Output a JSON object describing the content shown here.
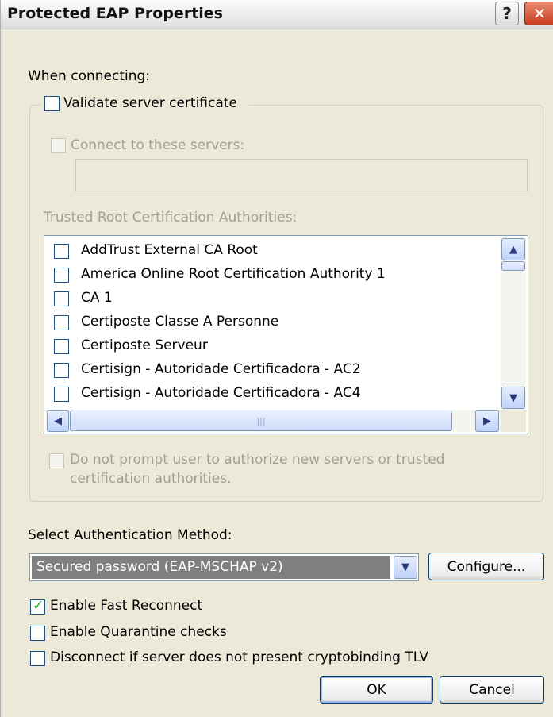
{
  "window": {
    "title": "Protected EAP Properties",
    "help_glyph": "?",
    "close_glyph": "✕"
  },
  "when_connecting_label": "When connecting:",
  "validate_cert": {
    "label": "Validate server certificate",
    "checked": false
  },
  "connect_servers": {
    "label": "Connect to these servers:",
    "checked": false,
    "enabled": false,
    "value": ""
  },
  "trusted_root_label": "Trusted Root Certification Authorities:",
  "ca_list": [
    {
      "label": "AddTrust External CA Root",
      "checked": false
    },
    {
      "label": "America Online Root Certification Authority 1",
      "checked": false
    },
    {
      "label": "CA 1",
      "checked": false
    },
    {
      "label": "Certiposte Classe A Personne",
      "checked": false
    },
    {
      "label": "Certiposte Serveur",
      "checked": false
    },
    {
      "label": "Certisign - Autoridade Certificadora - AC2",
      "checked": false
    },
    {
      "label": "Certisign - Autoridade Certificadora - AC4",
      "checked": false
    }
  ],
  "do_not_prompt": {
    "line1": "Do not prompt user to authorize new servers or trusted",
    "line2": "certification authorities.",
    "checked": false,
    "enabled": false
  },
  "auth_method_label": "Select Authentication Method:",
  "auth_method_value": "Secured password (EAP-MSCHAP v2)",
  "configure_button": "Configure...",
  "fast_reconnect": {
    "label": "Enable Fast Reconnect",
    "checked": true
  },
  "quarantine": {
    "label": "Enable Quarantine checks",
    "checked": false
  },
  "cryptobinding": {
    "label": "Disconnect if server does not present cryptobinding TLV",
    "checked": false
  },
  "ok_button": "OK",
  "cancel_button": "Cancel",
  "scroll_glyphs": {
    "up": "▲",
    "down": "▼",
    "left": "◀",
    "right": "▶",
    "grip": "|||",
    "dropdown": "▼",
    "check": "✓"
  },
  "colors": {
    "dialog_bg": "#ece9d8",
    "selection_bg": "#7f7f7f",
    "check_green": "#21a121",
    "close_red": "#c93c1c"
  }
}
